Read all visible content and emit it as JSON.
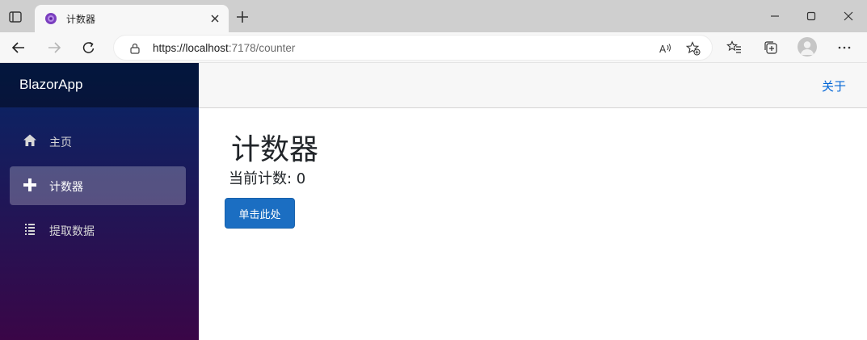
{
  "browser": {
    "tab_title": "计数器",
    "url_host": "https://localhost",
    "url_rest": ":7178/counter"
  },
  "app": {
    "brand": "BlazorApp",
    "nav": [
      {
        "label": "主页",
        "icon": "home-icon"
      },
      {
        "label": "计数器",
        "icon": "plus-icon",
        "active": true
      },
      {
        "label": "提取数据",
        "icon": "list-icon"
      }
    ],
    "about": "关于"
  },
  "main": {
    "title": "计数器",
    "count_prefix": "当前计数: ",
    "count": "0",
    "button_label": "单击此处"
  },
  "colors": {
    "accent": "#1b6ec2",
    "link": "#0366d6",
    "sidebar_top": "#052767",
    "sidebar_bottom": "#3a0647"
  }
}
